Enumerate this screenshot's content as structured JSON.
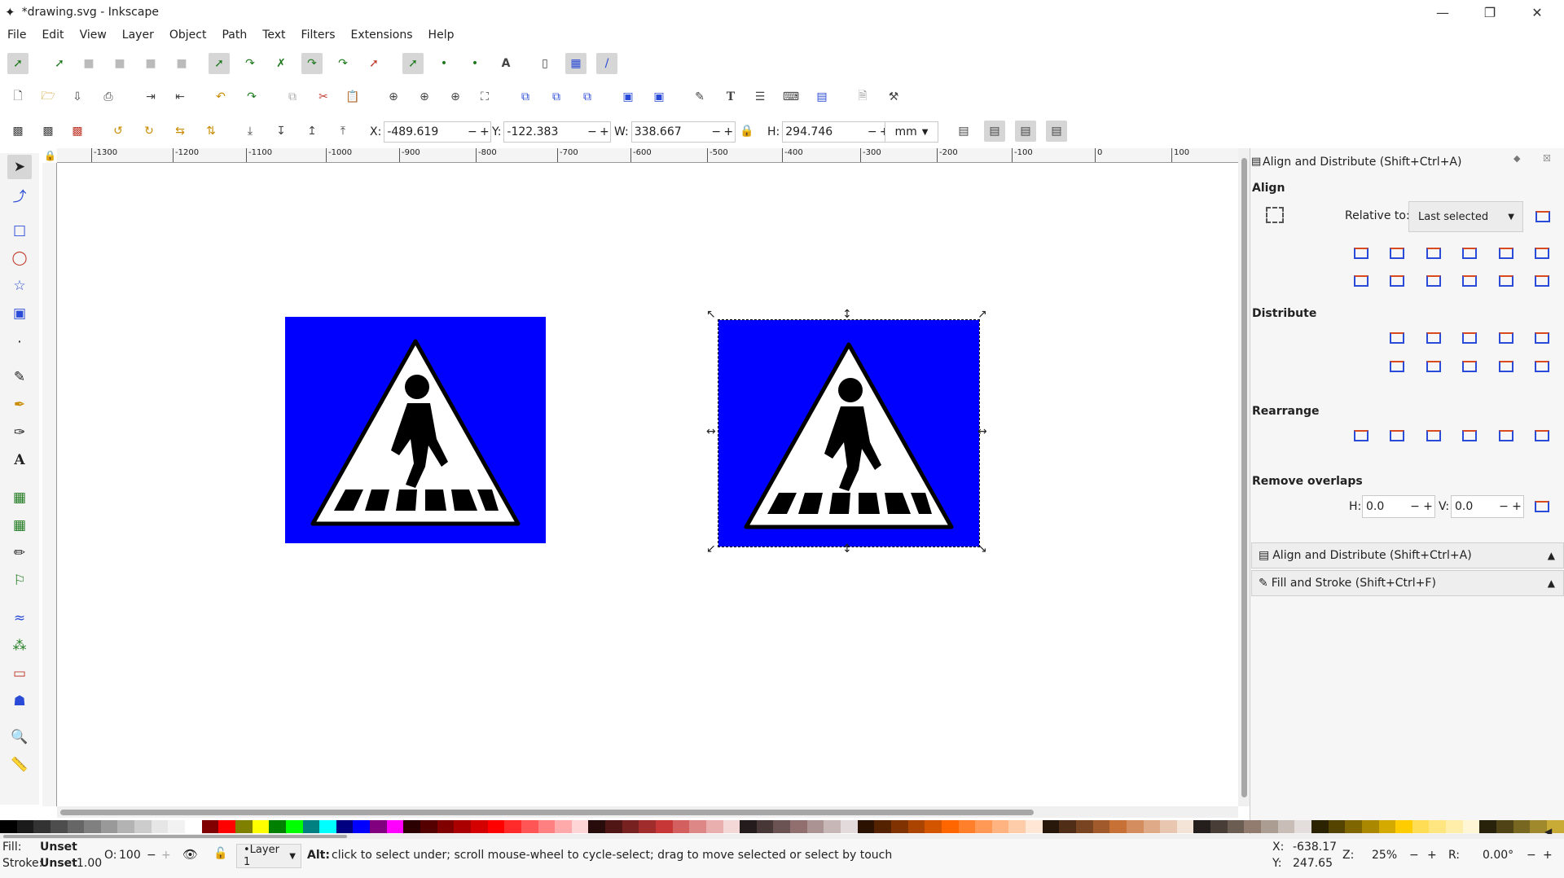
{
  "window": {
    "title": "*drawing.svg - Inkscape",
    "minimize": "—",
    "maximize": "❐",
    "close": "✕"
  },
  "menu": [
    "File",
    "Edit",
    "View",
    "Layer",
    "Object",
    "Path",
    "Text",
    "Filters",
    "Extensions",
    "Help"
  ],
  "coords": {
    "x_label": "X:",
    "x_value": "-489.619",
    "y_label": "Y:",
    "y_value": "-122.383",
    "w_label": "W:",
    "w_value": "338.667",
    "h_label": "H:",
    "h_value": "294.746",
    "unit": "mm"
  },
  "ruler_ticks": [
    "-1300",
    "-1200",
    "-1100",
    "-1000",
    "-900",
    "-800",
    "-700",
    "-600",
    "-500",
    "-400",
    "-300",
    "-200",
    "-100",
    "0",
    "100"
  ],
  "dock": {
    "panel_title": "Align and Distribute (Shift+Ctrl+A)",
    "align_label": "Align",
    "relative_label": "Relative to:",
    "relative_value": "Last selected",
    "distribute_label": "Distribute",
    "rearrange_label": "Rearrange",
    "remove_overlaps_label": "Remove overlaps",
    "h_label": "H:",
    "h_value": "0.0",
    "v_label": "V:",
    "v_value": "0.0",
    "collapsed_align": "Align and Distribute (Shift+Ctrl+A)",
    "collapsed_fill": "Fill and Stroke (Shift+Ctrl+F)"
  },
  "status": {
    "fill_label": "Fill:",
    "fill_value": "Unset",
    "stroke_label": "Stroke:",
    "stroke_value": "Unset",
    "stroke_width": "1.00",
    "opacity_label": "O:",
    "opacity_value": "100",
    "layer": "•Layer 1",
    "message_bold": "Alt:",
    "message": " click to select under; scroll mouse-wheel to cycle-select; drag to move selected or select by touch",
    "cursor_x_label": "X:",
    "cursor_x": "-638.17",
    "cursor_y_label": "Y:",
    "cursor_y": "247.65",
    "zoom_label": "Z:",
    "zoom_value": "25%",
    "rotate_label": "R:",
    "rotate_value": "0.00°"
  },
  "colors": {
    "sign_blue": "#0000ff",
    "palette": [
      "#000000",
      "#1a1a1a",
      "#333333",
      "#4d4d4d",
      "#666666",
      "#808080",
      "#999999",
      "#b3b3b3",
      "#cccccc",
      "#e6e6e6",
      "#f2f2f2",
      "#ffffff",
      "#800000",
      "#ff0000",
      "#808000",
      "#ffff00",
      "#008000",
      "#00ff00",
      "#008080",
      "#00ffff",
      "#000080",
      "#0000ff",
      "#800080",
      "#ff00ff",
      "#2b0000",
      "#550000",
      "#800000",
      "#aa0000",
      "#d40000",
      "#ff0000",
      "#ff2a2a",
      "#ff5555",
      "#ff8080",
      "#ffaaaa",
      "#ffd5d5",
      "#280b0b",
      "#501616",
      "#782121",
      "#a02c2c",
      "#c83737",
      "#d35f5f",
      "#de8787",
      "#e9afaf",
      "#f4d7d7",
      "#241c1c",
      "#483737",
      "#6c5353",
      "#916f6f",
      "#ac9393",
      "#c8b7b7",
      "#e3dbdb",
      "#2b1100",
      "#552200",
      "#803300",
      "#aa4400",
      "#d45500",
      "#ff6600",
      "#ff7f2a",
      "#ff9955",
      "#ffb380",
      "#ffccaa",
      "#ffe6d5",
      "#28170b",
      "#502d16",
      "#784421",
      "#a05a2c",
      "#c87137",
      "#d38d5f",
      "#deaa87",
      "#e9c6af",
      "#f4e3d7",
      "#241f1c",
      "#483e37",
      "#6c5d53",
      "#917c6f",
      "#ac9d93",
      "#c8beb7",
      "#e3dedb",
      "#2b2200",
      "#554400",
      "#806600",
      "#aa8800",
      "#d4aa00",
      "#ffcc00",
      "#ffdd55",
      "#ffe680",
      "#ffeeaa",
      "#fff6d5",
      "#28220b",
      "#504416",
      "#786721",
      "#a0892c",
      "#c8ab37"
    ]
  }
}
